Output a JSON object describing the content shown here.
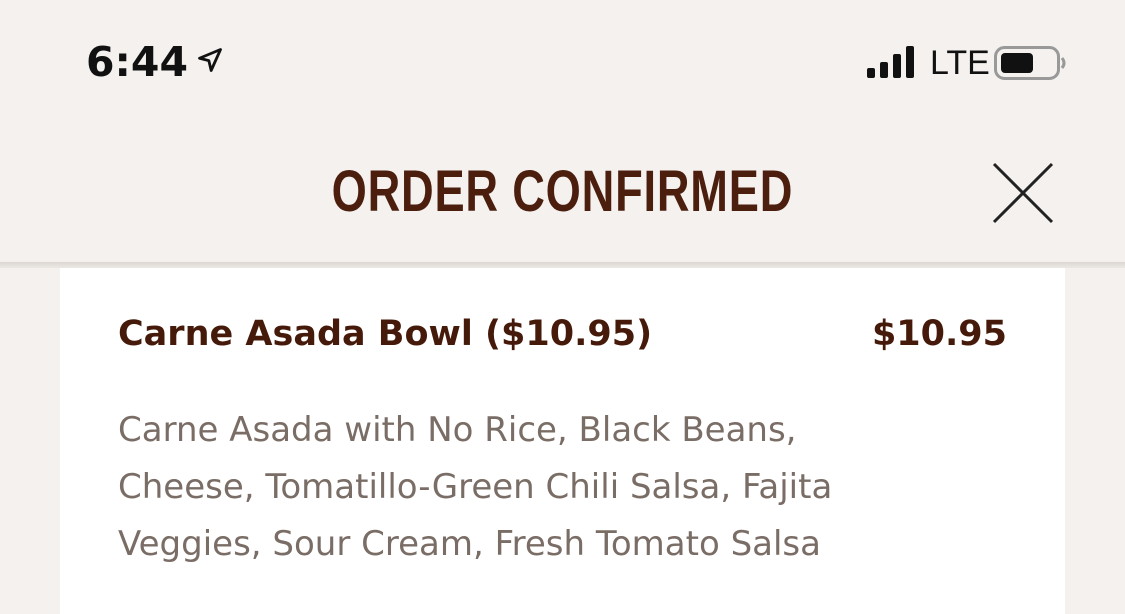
{
  "status_bar": {
    "time": "6:44",
    "network": "LTE"
  },
  "header": {
    "title": "ORDER CONFIRMED"
  },
  "order_item": {
    "name": "Carne Asada Bowl ($10.95)",
    "price": "$10.95",
    "description": "Carne Asada with No Rice, Black Beans, Cheese, Tomatillo-Green Chili Salsa, Fajita Veggies, Sour Cream, Fresh Tomato Salsa"
  },
  "colors": {
    "brand_brown": "#451a0a",
    "description_gray": "#7a6d66",
    "background": "#f4f1ee"
  },
  "icons": [
    "location-arrow-icon",
    "signal-icon",
    "battery-icon",
    "close-icon"
  ]
}
